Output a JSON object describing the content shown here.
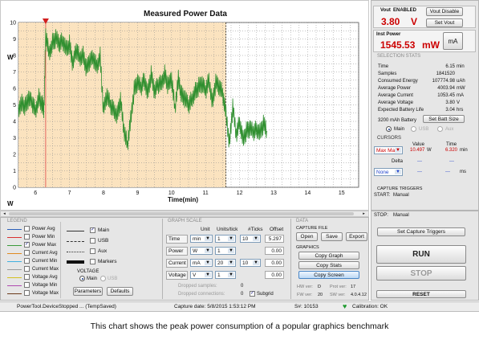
{
  "chart": {
    "title": "Measured Power Data",
    "xlabel": "Time(min)",
    "ylabel": "W",
    "y_ticks": [
      "10",
      "9",
      "8",
      "7",
      "6",
      "5",
      "4",
      "3",
      "2",
      "1",
      "0"
    ],
    "x_ticks": [
      "6",
      "7",
      "8",
      "9",
      "10",
      "11",
      "12",
      "13",
      "14",
      "15"
    ]
  },
  "chart_data": {
    "type": "line",
    "title": "Measured Power Data",
    "xlabel": "Time(min)",
    "ylabel": "W",
    "xlim": [
      5.5,
      15.5
    ],
    "ylim": [
      0,
      10
    ],
    "grid": true,
    "cursor_marker_x": 6.3,
    "highlight_region_x": [
      5.5,
      11.6
    ],
    "series": [
      {
        "x": [
          5.5,
          5.6,
          5.7,
          5.8,
          5.9,
          6.0,
          6.1,
          6.2,
          6.25,
          6.3,
          6.4,
          6.5,
          6.6,
          6.7,
          6.8,
          6.9,
          7.0,
          7.1,
          7.2,
          7.3,
          7.4,
          7.5,
          7.6,
          7.7,
          7.8,
          7.9,
          8.0,
          8.1,
          8.2,
          8.3,
          8.4,
          8.5,
          8.6,
          8.7,
          8.8,
          8.9,
          9.0,
          9.1,
          9.2,
          9.3,
          9.4,
          9.5,
          9.6,
          9.7,
          9.8,
          9.9,
          10.0,
          10.1,
          10.2,
          10.3,
          10.4,
          10.5,
          10.6,
          10.7,
          10.8,
          10.9,
          11.0,
          11.1,
          11.2,
          11.3,
          11.4,
          11.5,
          11.6,
          11.7,
          11.8,
          11.9,
          12.0,
          12.1,
          12.2,
          12.3,
          12.4,
          12.5,
          12.6,
          12.7,
          12.8
        ],
        "y": [
          4.8,
          5.2,
          4.9,
          5.3,
          5.1,
          4.7,
          5.5,
          5.0,
          4.6,
          9.3,
          8.2,
          8.8,
          9.0,
          8.6,
          8.9,
          8.5,
          8.7,
          7.4,
          8.3,
          7.9,
          8.1,
          7.2,
          7.6,
          7.8,
          7.4,
          8.0,
          4.6,
          5.5,
          5.0,
          4.8,
          4.4,
          5.2,
          3.4,
          2.6,
          4.2,
          5.9,
          6.3,
          6.0,
          6.6,
          5.8,
          6.8,
          5.7,
          6.2,
          6.4,
          6.9,
          6.1,
          6.5,
          4.8,
          6.7,
          5.6,
          5.3,
          4.9,
          5.4,
          5.9,
          6.1,
          6.2,
          5.8,
          6.6,
          5.2,
          6.3,
          6.0,
          5.7,
          4.6,
          2.7,
          4.8,
          3.1,
          4.0,
          3.0,
          3.4,
          3.5,
          3.3,
          3.6,
          3.4,
          3.8,
          3.4
        ]
      }
    ]
  },
  "top": {
    "vout_label": "Vout",
    "vout_status": "ENABLED",
    "vout_disable_label": "Vout Disable",
    "vout_value": "3.80",
    "vout_unit": "V",
    "set_vout_label": "Set Vout",
    "inst_power_label": "Inst Power",
    "inst_power_value": "1545.53",
    "inst_power_unit": "mW",
    "ma_button": "mA"
  },
  "stats": {
    "header": "SELECTION STATS",
    "rows": [
      {
        "k": "Time",
        "v": "6.15",
        "u": "min"
      },
      {
        "k": "Samples",
        "v": "1841520",
        "u": ""
      },
      {
        "k": "Consumed Energy",
        "v": "107774.98",
        "u": "uAh"
      },
      {
        "k": "Average Power",
        "v": "4003.94",
        "u": "mW"
      },
      {
        "k": "Average Current",
        "v": "1053.45",
        "u": "mA"
      },
      {
        "k": "Average Voltage",
        "v": "3.80",
        "u": "V"
      },
      {
        "k": "Expected Battery Life",
        "v": "3.04",
        "u": "hrs"
      }
    ],
    "battery_value": "3200",
    "battery_unit": "mAh Battery",
    "set_batt_label": "Set Batt Size",
    "radio_main": "Main",
    "radio_usb": "USB",
    "radio_aux": "Aux"
  },
  "cursors": {
    "header": "CURSORS",
    "value_hdr": "Value",
    "time_hdr": "Time",
    "row1_sel": "Max Max",
    "row1_value": "10.497",
    "row1_unit": "W",
    "row1_time": "6.320",
    "row1_time_unit": "min",
    "delta_label": "Delta",
    "delta_value": "---",
    "delta_time": "---",
    "row2_sel": "None",
    "row2_value": "---",
    "row2_time": "---",
    "row2_time_unit": "ms"
  },
  "triggers": {
    "header": "CAPTURE TRIGGERS",
    "start_label": "START:",
    "start_value": "Manual",
    "stop_label": "STOP:",
    "stop_value": "Manual",
    "set_label": "Set Capture Triggers"
  },
  "controls": {
    "run": "RUN",
    "stop": "STOP",
    "reset": "RESET"
  },
  "legend": {
    "header": "LEGEND",
    "items": [
      {
        "label": "Power Avg",
        "color": "#2b5fb8",
        "checked": ""
      },
      {
        "label": "Power Min",
        "color": "#d93030",
        "checked": ""
      },
      {
        "label": "Power Max",
        "color": "#3a9a3a",
        "checked": "✓"
      },
      {
        "label": "Current Avg",
        "color": "#e08a20",
        "checked": ""
      },
      {
        "label": "Current Min",
        "color": "#40b0e0",
        "checked": ""
      },
      {
        "label": "Current Max",
        "color": "#9a9a9a",
        "checked": ""
      },
      {
        "label": "Voltage Avg",
        "color": "#d4c020",
        "checked": ""
      },
      {
        "label": "Voltage Min",
        "color": "#b04ab0",
        "checked": ""
      },
      {
        "label": "Voltage Max",
        "color": "#6b3a1a",
        "checked": ""
      }
    ],
    "src_main": "Main",
    "src_usb": "USB",
    "src_aux": "Aux",
    "markers": "Markers",
    "voltage_header": "VOLTAGE",
    "v_main": "Main",
    "v_usb": "USB",
    "parameters": "Parameters",
    "defaults": "Defaults"
  },
  "scale": {
    "header": "GRAPH SCALE",
    "unit_hdr": "Unit",
    "uticks_hdr": "Units/tick",
    "nticks_hdr": "#Ticks",
    "offset_hdr": "Offset",
    "rows": [
      {
        "name": "Time",
        "unit": "min",
        "upt": "1",
        "ticks": "10",
        "offset": "5.297"
      },
      {
        "name": "Power",
        "unit": "W",
        "upt": "1",
        "ticks": "",
        "offset": "0.00"
      },
      {
        "name": "Current",
        "unit": "mA",
        "upt": "20",
        "ticks": "10",
        "offset": "0.00"
      },
      {
        "name": "Voltage",
        "unit": "V",
        "upt": "1",
        "ticks": "",
        "offset": "0.00"
      }
    ],
    "dropped_samples": "Dropped samples:",
    "dropped_samples_v": "0",
    "dropped_conn": "Dropped connections:",
    "dropped_conn_v": "0",
    "subgrid": "Subgrid"
  },
  "data": {
    "header": "DATA",
    "capture_file": "CAPTURE FILE",
    "open": "Open",
    "save": "Save",
    "export": "Export",
    "graphics": "GRAPHICS",
    "copy_graph": "Copy Graph",
    "copy_stats": "Copy Stats",
    "copy_screen": "Copy Screen",
    "hw_label": "HW ver:",
    "hw_value": "D",
    "fw_label": "FW ver:",
    "fw_value": "20",
    "prot_label": "Prot ver:",
    "prot_value": "17",
    "sw_label": "SW ver:",
    "sw_value": "4.0.4.12"
  },
  "status": {
    "left": "PowerTool.DeviceStopped ... (TempSaved)",
    "capture_date": "Capture date: 5/8/2015 1:53:12 PM",
    "serial": "S#: 10153",
    "calibration": "Calibration: OK"
  },
  "caption": "This chart shows the peak power consumption of a popular graphics benchmark"
}
